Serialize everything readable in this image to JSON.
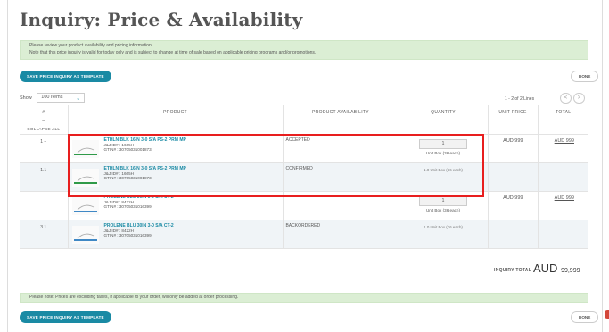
{
  "page": {
    "title": "Inquiry: Price & Availability",
    "notice_line1": "Please review your product availability and pricing information.",
    "notice_line2": "Note that this price inquiry is valid for today only and is subject to change at time of sale based on applicable pricing programs and/or promotions."
  },
  "toolbar": {
    "save_template_label": "SAVE PRICE INQUIRY AS TEMPLATE",
    "done_label": "DONE"
  },
  "listing": {
    "show_label": "Show",
    "show_value": "100 Items",
    "pager_text": "1 - 2 of 2 Lines",
    "prev_label": "<",
    "next_label": ">"
  },
  "table": {
    "headers": {
      "line": "#",
      "dash": "–",
      "collapse_all": "COLLAPSE ALL",
      "product": "PRODUCT",
      "availability": "PRODUCT AVAILABILITY",
      "quantity": "QUANTITY",
      "unit_price": "UNIT PRICE",
      "total": "TOTAL"
    },
    "rows": [
      {
        "line": "1  −",
        "name": "ETHLN BLK 16IN 3-0 S/A PS-2 PRM MP",
        "id": "J&J ID# : 1665H",
        "gtin": "GTIN# : 30705031001873",
        "availability": "ACCEPTED",
        "qty": "1",
        "unit": "Unit Box (36 each)",
        "unit_price": "AUD 999",
        "total": "AUD 999"
      },
      {
        "line": "1.1",
        "name": "ETHLN BLK 16IN 3-0 S/A PS-2 PRM MP",
        "id": "J&J ID# : 1665H",
        "gtin": "GTIN# : 30705031001873",
        "availability": "CONFIRMED",
        "qty_flat": "1.0 Unit Box (36 each)"
      },
      {
        "line": "",
        "name": "PROLENE BLU 30IN 3-0 S/A CT-2",
        "id": "J&J ID# : 8422H",
        "gtin": "GTIN# : 30705031016399",
        "availability": "",
        "qty": "1",
        "unit": "Unit Box (36 each)",
        "unit_price": "AUD 999",
        "total": "AUD 999"
      },
      {
        "line": "3.1",
        "name": "PROLENE BLU 30IN 3-0 S/A CT-2",
        "id": "J&J ID# : 8422H",
        "gtin": "GTIN# : 30705031016399",
        "availability": "BACKORDERED",
        "qty_flat": "1.0 Unit Box (36 each)"
      }
    ]
  },
  "totals": {
    "label": "INQUIRY TOTAL",
    "currency": "AUD",
    "value": "99,999"
  },
  "footer": {
    "note": "Please note: Prices are excluding taxes, if applicable to your order, will only be added at order processing."
  },
  "colors": {
    "accent": "#1a8aa4",
    "notice_bg": "#dbeed4",
    "highlight_border": "#e81e1e"
  }
}
